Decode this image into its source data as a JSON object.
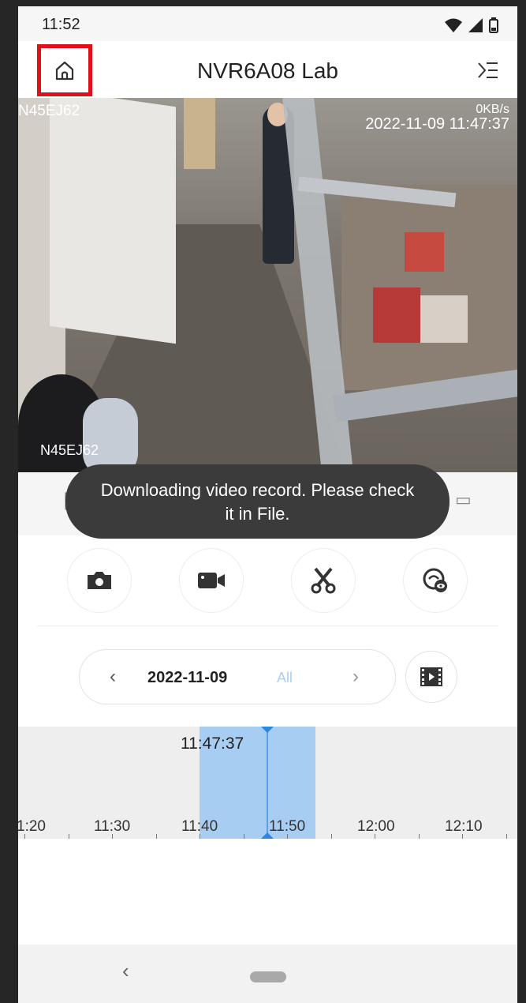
{
  "status_bar": {
    "time": "11:52"
  },
  "app_bar": {
    "title": "NVR6A08 Lab"
  },
  "video": {
    "camera_label_top": "N45EJ62",
    "bitrate": "0KB/s",
    "timestamp": "2022-11-09 11:47:37",
    "camera_label_bottom": "N45EJ62"
  },
  "toast": {
    "line1": "Downloading video record. Please check",
    "line2": "it in File."
  },
  "date_selector": {
    "date": "2022-11-09",
    "filter": "All"
  },
  "timeline": {
    "current_time": "11:47:37",
    "ticks": [
      "1:20",
      "11:30",
      "11:40",
      "11:50",
      "12:00",
      "12:10"
    ]
  },
  "colors": {
    "highlight": "#e0101a",
    "selection": "#a8cdf3",
    "accent": "#2f86de"
  },
  "icons": {
    "home": "home-icon",
    "menu": "menu-icon",
    "snapshot": "camera-icon",
    "record": "video-camera-icon",
    "clip": "scissors-icon",
    "view": "eye-icon",
    "filmstrip": "film-icon"
  }
}
